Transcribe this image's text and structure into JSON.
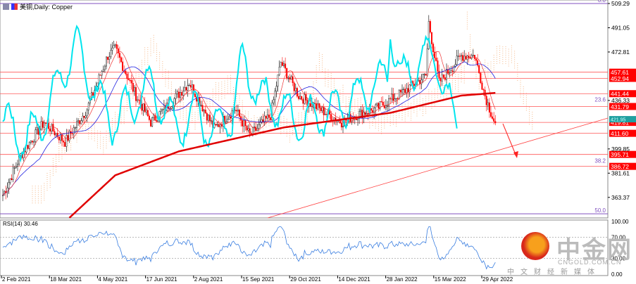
{
  "window": {
    "title": "美铜,Daily:  Copper",
    "rsi_label": "RSI(14) 30.46"
  },
  "price_axis": [
    "509.29",
    "491.05",
    "472.81",
    "436.33",
    "399.85",
    "381.61",
    "363.37"
  ],
  "price_tags": [
    {
      "label": "457.61",
      "price": 457.61
    },
    {
      "label": "452.94",
      "price": 452.94
    },
    {
      "label": "441.44",
      "price": 441.44
    },
    {
      "label": "431.79",
      "price": 431.79
    },
    {
      "label": "419.81",
      "price": 419.81
    },
    {
      "label": "411.60",
      "price": 411.6
    },
    {
      "label": "395.71",
      "price": 395.71
    },
    {
      "label": "386.72",
      "price": 386.72
    }
  ],
  "current_price_tag": {
    "label": "421.95",
    "price": 421.95
  },
  "fibo": [
    {
      "label": "0.0",
      "price": 509.29
    },
    {
      "label": "23.6",
      "price": 434.5
    },
    {
      "label": "38.2",
      "price": 388.3
    },
    {
      "label": "50.0",
      "price": 351.0
    }
  ],
  "rsi_axis": [
    "100.00",
    "70.00",
    "30.00",
    "0.00"
  ],
  "date_axis": [
    "2 Feb 2021",
    "18 Mar 2021",
    "4 May 2021",
    "17 Jun 2021",
    "2 Aug 2021",
    "15 Sep 2021",
    "29 Oct 2021",
    "14 Dec 2021",
    "28 Jan 2022",
    "15 Mar 2022",
    "29 Apr 2022"
  ],
  "watermark": {
    "cn": "中金网",
    "en": "CNGOLD.COM.CN",
    "sub": "中文财经新媒体"
  },
  "colors": {
    "up": "#000000",
    "down": "#ff0000",
    "ma200": "#e00000",
    "cyan": "#00e5ee",
    "blue": "#2020e0",
    "fibo": "#8050c0",
    "tag": "#ff0000"
  },
  "chart_data": {
    "type": "candlestick",
    "title": "美铜,Daily:  Copper",
    "price_keypoints": [
      [
        0,
        365
      ],
      [
        12,
        395
      ],
      [
        28,
        420
      ],
      [
        42,
        405
      ],
      [
        57,
        430
      ],
      [
        71,
        470
      ],
      [
        76,
        475
      ],
      [
        90,
        440
      ],
      [
        100,
        420
      ],
      [
        114,
        435
      ],
      [
        126,
        450
      ],
      [
        143,
        415
      ],
      [
        157,
        430
      ],
      [
        167,
        410
      ],
      [
        181,
        425
      ],
      [
        188,
        465
      ],
      [
        200,
        440
      ],
      [
        214,
        430
      ],
      [
        229,
        420
      ],
      [
        238,
        425
      ],
      [
        252,
        430
      ],
      [
        267,
        440
      ],
      [
        286,
        455
      ],
      [
        288,
        495
      ],
      [
        295,
        450
      ],
      [
        310,
        470
      ],
      [
        319,
        470
      ],
      [
        326,
        440
      ],
      [
        333,
        418
      ]
    ],
    "ma200_keypoints": [
      [
        45,
        348
      ],
      [
        76,
        380
      ],
      [
        119,
        398
      ],
      [
        190,
        416
      ],
      [
        262,
        427
      ],
      [
        310,
        440
      ],
      [
        333,
        442
      ]
    ],
    "rsi_last": 30.46,
    "ylim": [
      345,
      510
    ]
  }
}
